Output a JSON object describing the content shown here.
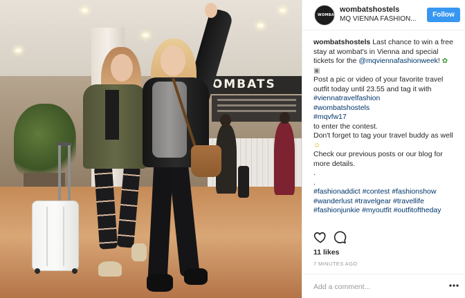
{
  "post": {
    "username": "wombatshostels",
    "location": "MQ VIENNA FASHION...",
    "follow_label": "Follow",
    "photo_sign": "WOMBATS",
    "avatar_text": "WOMBATS"
  },
  "caption": {
    "username": "wombatshostels",
    "line1": " Last chance to win a free",
    "line2": "stay at wombat's in Vienna and special",
    "line3_text": "tickets for the ",
    "line3_mention": "@mqviennafashionweek",
    "line3_end": "!",
    "line5": "Post a pic or video of your favorite travel",
    "line6": "outfit today until 23.55 and tag it with",
    "tag1": "#viennatravelfashion",
    "tag2": "#wombatshostels",
    "tag3": "#mqvfw17",
    "line10": "to enter the contest.",
    "line11": "Don't forget to tag your travel buddy as well",
    "line13": "Check our previous posts or our blog for",
    "line14": "more details.",
    "dot1": ".",
    "dot2": ".",
    "hashtags_row1": [
      "#fashionaddict",
      "#contest",
      "#fashionshow"
    ],
    "hashtags_row2": [
      "#wanderlust",
      "#travelgear",
      "#travellife"
    ],
    "hashtags_row3": [
      "#fashionjunkie",
      "#myoutfit",
      "#outfitoftheday"
    ]
  },
  "engagement": {
    "likes": "11 likes",
    "time": "7 MINUTES AGO"
  },
  "comment": {
    "placeholder": "Add a comment..."
  },
  "icons": {
    "like": "heart-icon",
    "comment": "comment-icon",
    "more": "more-options-icon",
    "emoji_clover": "four-leaf-clover-emoji",
    "emoji_camera": "camera-emoji",
    "emoji_wink": "winking-face-emoji"
  },
  "colors": {
    "follow_button": "#3897f0",
    "link": "#003569",
    "muted_text": "#999999",
    "text": "#262626"
  }
}
